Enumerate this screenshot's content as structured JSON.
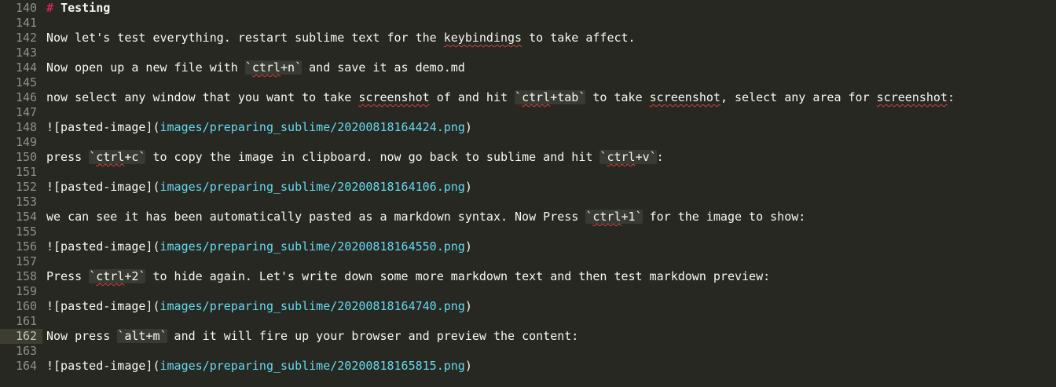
{
  "editor": {
    "current_line": "162",
    "lines": [
      {
        "num": "140",
        "parts": [
          {
            "t": "# ",
            "c": "heading-mark"
          },
          {
            "t": "Testing",
            "c": "heading-text"
          }
        ]
      },
      {
        "num": "141",
        "parts": []
      },
      {
        "num": "142",
        "parts": [
          {
            "t": "Now let's test everything. restart sublime text for the "
          },
          {
            "t": "keybindings",
            "c": "squig"
          },
          {
            "t": " to take affect."
          }
        ]
      },
      {
        "num": "143",
        "parts": []
      },
      {
        "num": "144",
        "parts": [
          {
            "t": "Now open up a new file with "
          },
          {
            "t": "`ctrl+n`",
            "c": "code",
            "sq": "ctrl"
          },
          {
            "t": " and save it as demo.md"
          }
        ]
      },
      {
        "num": "145",
        "parts": []
      },
      {
        "num": "146",
        "parts": [
          {
            "t": "now select any window that you want to take "
          },
          {
            "t": "screenshot",
            "c": "squig"
          },
          {
            "t": " of and hit "
          },
          {
            "t": "`ctrl+tab`",
            "c": "code",
            "sq": "ctrl"
          },
          {
            "t": " to take "
          },
          {
            "t": "screenshot",
            "c": "squig"
          },
          {
            "t": ", select any area for "
          },
          {
            "t": "screenshot",
            "c": "squig"
          },
          {
            "t": ":"
          }
        ]
      },
      {
        "num": "147",
        "parts": []
      },
      {
        "num": "148",
        "parts": [
          {
            "t": "![pasted-image]("
          },
          {
            "t": "images/preparing_sublime/20200818164424.png",
            "c": "link-url"
          },
          {
            "t": ")"
          }
        ]
      },
      {
        "num": "149",
        "parts": []
      },
      {
        "num": "150",
        "parts": [
          {
            "t": "press "
          },
          {
            "t": "`ctrl+c`",
            "c": "code",
            "sq": "ctrl"
          },
          {
            "t": " to copy the image in clipboard. now go back to sublime and hit "
          },
          {
            "t": "`ctrl+v`",
            "c": "code",
            "sq": "ctrl"
          },
          {
            "t": ":"
          }
        ]
      },
      {
        "num": "151",
        "parts": []
      },
      {
        "num": "152",
        "parts": [
          {
            "t": "![pasted-image]("
          },
          {
            "t": "images/preparing_sublime/20200818164106.png",
            "c": "link-url"
          },
          {
            "t": ")"
          }
        ]
      },
      {
        "num": "153",
        "parts": []
      },
      {
        "num": "154",
        "parts": [
          {
            "t": "we can see it has been automatically pasted as a markdown syntax. Now Press "
          },
          {
            "t": "`ctrl+1`",
            "c": "code",
            "sq": "ctrl"
          },
          {
            "t": " for the image to show:"
          }
        ]
      },
      {
        "num": "155",
        "parts": []
      },
      {
        "num": "156",
        "parts": [
          {
            "t": "![pasted-image]("
          },
          {
            "t": "images/preparing_sublime/20200818164550.png",
            "c": "link-url"
          },
          {
            "t": ")"
          }
        ]
      },
      {
        "num": "157",
        "parts": []
      },
      {
        "num": "158",
        "parts": [
          {
            "t": "Press "
          },
          {
            "t": "`ctrl+2`",
            "c": "code",
            "sq": "ctrl"
          },
          {
            "t": " to hide again. Let's write down some more markdown text and then test markdown preview:"
          }
        ]
      },
      {
        "num": "159",
        "parts": []
      },
      {
        "num": "160",
        "parts": [
          {
            "t": "![pasted-image]("
          },
          {
            "t": "images/preparing_sublime/20200818164740.png",
            "c": "link-url"
          },
          {
            "t": ")"
          }
        ]
      },
      {
        "num": "161",
        "parts": []
      },
      {
        "num": "162",
        "parts": [
          {
            "t": "Now press "
          },
          {
            "t": "`alt+m`",
            "c": "code"
          },
          {
            "t": " and it will fire up your browser and preview the content:"
          }
        ]
      },
      {
        "num": "163",
        "parts": []
      },
      {
        "num": "164",
        "parts": [
          {
            "t": "![pasted-image]("
          },
          {
            "t": "images/preparing_sublime/20200818165815.png",
            "c": "link-url"
          },
          {
            "t": ")"
          }
        ]
      }
    ]
  }
}
